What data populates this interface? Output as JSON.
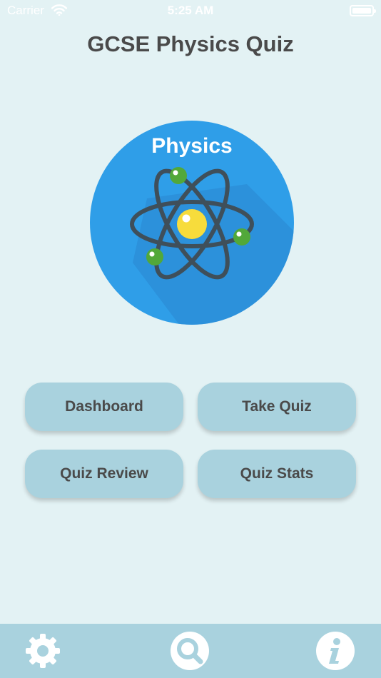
{
  "status_bar": {
    "carrier": "Carrier",
    "time": "5:25 AM",
    "wifi_icon": "wifi-icon",
    "battery_icon": "battery-icon"
  },
  "header": {
    "title": "GCSE Physics Quiz"
  },
  "logo": {
    "label": "Physics",
    "icon": "atom-icon",
    "colors": {
      "circle": "#2f9ee8",
      "nucleus": "#f7dc3c",
      "electron": "#52a83a"
    }
  },
  "menu": {
    "dashboard_label": "Dashboard",
    "take_quiz_label": "Take Quiz",
    "quiz_review_label": "Quiz Review",
    "quiz_stats_label": "Quiz Stats"
  },
  "tab_bar": {
    "items": [
      {
        "icon": "gear-icon"
      },
      {
        "icon": "search-icon"
      },
      {
        "icon": "info-icon"
      }
    ]
  },
  "colors": {
    "background": "#e3f2f4",
    "button": "#a9d2de",
    "tab_bar": "#a9d2de",
    "title_text": "#4a4a4a"
  }
}
